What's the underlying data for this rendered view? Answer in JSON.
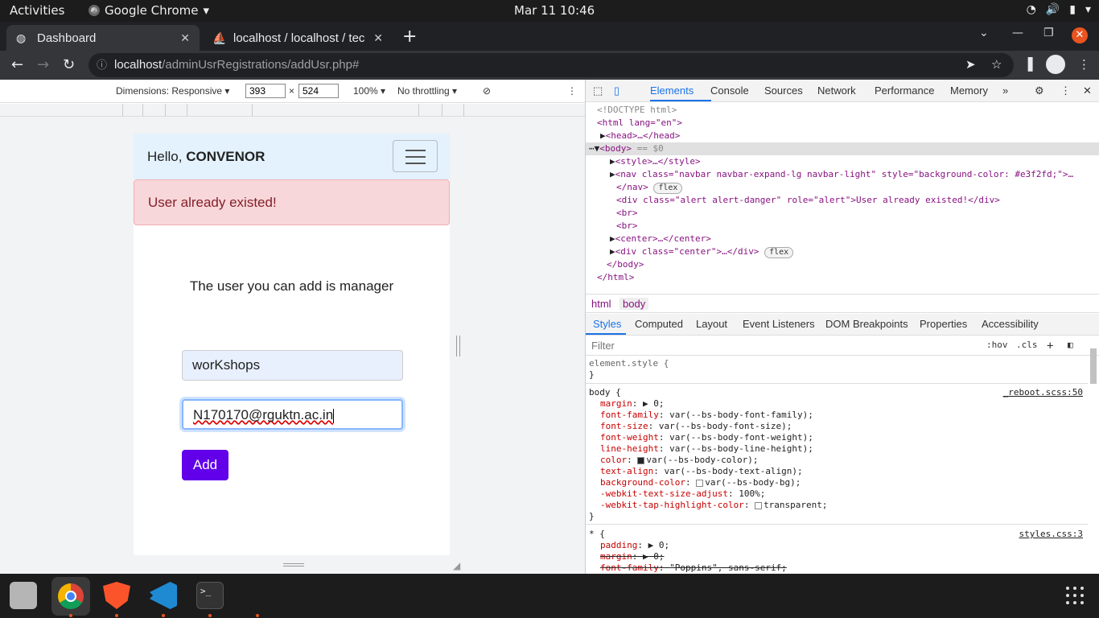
{
  "system": {
    "activities": "Activities",
    "app_name": "Google Chrome",
    "clock": "Mar 11  10:46"
  },
  "browser": {
    "tabs": [
      {
        "title": "Dashboard",
        "active": true
      },
      {
        "title": "localhost / localhost / tec",
        "active": false
      }
    ],
    "url_host": "localhost",
    "url_path": "/adminUsrRegistrations/addUsr.php#"
  },
  "device_toolbar": {
    "dimensions_label": "Dimensions: Responsive",
    "width": "393",
    "height": "524",
    "times": "×",
    "zoom": "100%",
    "throttling": "No throttling"
  },
  "page": {
    "greeting_prefix": "Hello, ",
    "greeting_name": "CONVENOR",
    "alert": "User already existed!",
    "message": "The user you can add is manager",
    "role_field_value": "worKshops",
    "email_field_value": "N170170@rguktn.ac.in",
    "add_button": "Add"
  },
  "devtools": {
    "tabs": [
      "Elements",
      "Console",
      "Sources",
      "Network",
      "Performance",
      "Memory"
    ],
    "more": "»",
    "breadcrumbs": [
      "html",
      "body"
    ],
    "subtabs": [
      "Styles",
      "Computed",
      "Layout",
      "Event Listeners",
      "DOM Breakpoints",
      "Properties",
      "Accessibility"
    ],
    "filter_placeholder": "Filter",
    "hov": ":hov",
    "cls": ".cls",
    "dom_lines": {
      "doctype": "<!DOCTYPE html>",
      "html_open": "<html lang=\"en\">",
      "head": "<head>…</head>",
      "body_open": "<body>",
      "body_marker": "== $0",
      "style": "<style>…</style>",
      "nav": "<nav class=\"navbar navbar-expand-lg navbar-light\" style=\"background-color: #e3f2fd;\">…",
      "nav_close": "</nav>",
      "flex": "flex",
      "alert_div": "<div class=\"alert alert-danger\" role=\"alert\">User already existed!</div>",
      "br": "<br>",
      "center": "<center>…</center>",
      "div_center": "<div class=\"center\">…</div>",
      "body_close": "</body>",
      "html_close": "</html>"
    },
    "styles": {
      "element_style": "element.style {",
      "close_brace": "}",
      "body_selector": "body {",
      "body_source": "_reboot.scss:50",
      "body_props": [
        [
          "margin",
          "▶ 0;"
        ],
        [
          "font-family",
          "var(--bs-body-font-family);"
        ],
        [
          "font-size",
          "var(--bs-body-font-size);"
        ],
        [
          "font-weight",
          "var(--bs-body-font-weight);"
        ],
        [
          "line-height",
          "var(--bs-body-line-height);"
        ],
        [
          "color",
          "var(--bs-body-color);"
        ],
        [
          "text-align",
          "var(--bs-body-text-align);"
        ],
        [
          "background-color",
          "var(--bs-body-bg);"
        ],
        [
          "-webkit-text-size-adjust",
          "100%;"
        ],
        [
          "-webkit-tap-highlight-color",
          "transparent;"
        ]
      ],
      "star_selector": "* {",
      "star_source": "styles.css:3",
      "star_props": [
        [
          "padding",
          "▶ 0;",
          false
        ],
        [
          "margin",
          "▶ 0;",
          true
        ],
        [
          "font-family",
          "\"Poppins\", sans-serif;",
          true
        ]
      ]
    }
  },
  "colors": {
    "navbar_bg": "#e3f2fd",
    "alert_bg": "#f8d7da",
    "alert_text": "#842029",
    "add_button_bg": "#6200ea",
    "devtools_accent": "#1a73e8"
  }
}
